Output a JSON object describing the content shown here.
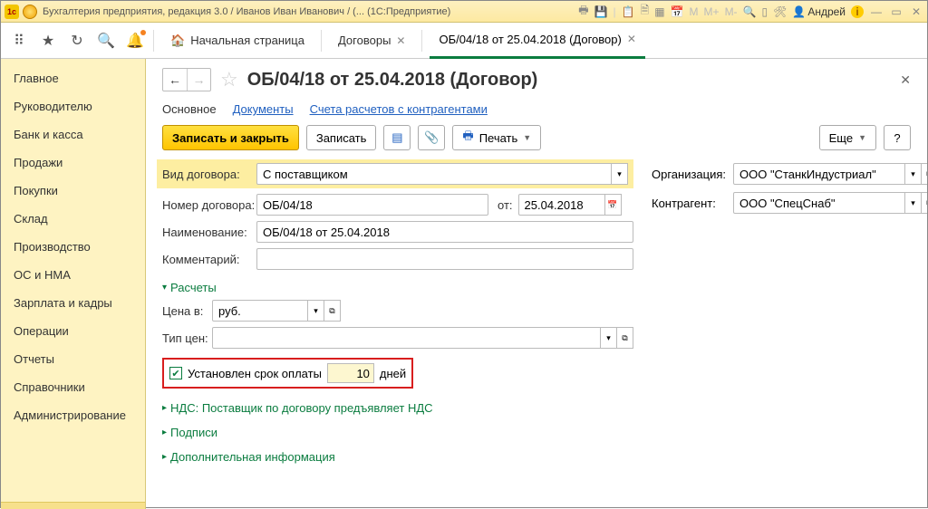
{
  "titlebar": {
    "app": "Бухгалтерия предприятия, редакция 3.0 / Иванов Иван Иванович / (...  (1С:Предприятие)",
    "user": "Андрей",
    "m_labels": [
      "M",
      "M+",
      "M-"
    ]
  },
  "toolbar": {
    "home_tab": "Начальная страница",
    "tabs": [
      {
        "label": "Договоры"
      },
      {
        "label": "ОБ/04/18 от 25.04.2018 (Договор)",
        "active": true
      }
    ]
  },
  "sidebar": {
    "items": [
      "Главное",
      "Руководителю",
      "Банк и касса",
      "Продажи",
      "Покупки",
      "Склад",
      "Производство",
      "ОС и НМА",
      "Зарплата и кадры",
      "Операции",
      "Отчеты",
      "Справочники",
      "Администрирование"
    ]
  },
  "page": {
    "title": "ОБ/04/18 от 25.04.2018 (Договор)",
    "subtabs": {
      "main": "Основное",
      "docs": "Документы",
      "accounts": "Счета расчетов с контрагентами"
    },
    "cmd": {
      "save_close": "Записать и закрыть",
      "save": "Записать",
      "print": "Печать",
      "more": "Еще"
    }
  },
  "form": {
    "contract_kind_label": "Вид договора:",
    "contract_kind": "С поставщиком",
    "number_label": "Номер договора:",
    "number": "ОБ/04/18",
    "date_label": "от:",
    "date": "25.04.2018",
    "name_label": "Наименование:",
    "name": "ОБ/04/18 от 25.04.2018",
    "comment_label": "Комментарий:",
    "comment": "",
    "org_label": "Организация:",
    "org": "ООО \"СтанкИндустриал\"",
    "counter_label": "Контрагент:",
    "counter": "ООО \"СпецСнаб\"",
    "calc_expander": "Расчеты",
    "price_label": "Цена в:",
    "price_currency": "руб.",
    "price_type_label": "Тип цен:",
    "price_type": "",
    "deadline_label": "Установлен срок оплаты",
    "deadline_days": "10",
    "deadline_suffix": "дней",
    "nds": "НДС: Поставщик по договору предъявляет НДС",
    "sign": "Подписи",
    "extra": "Дополнительная информация"
  }
}
